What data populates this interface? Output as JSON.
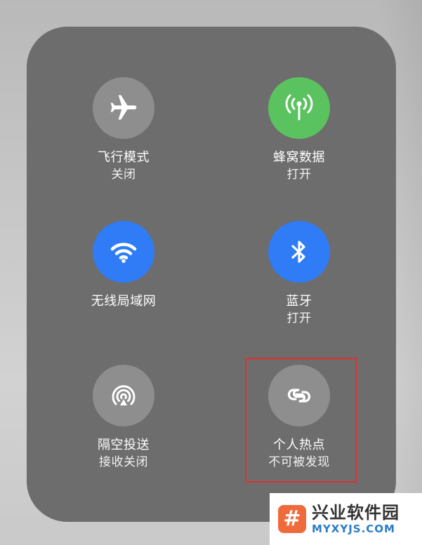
{
  "colors": {
    "panel": "#6d6d6d",
    "inactive": "#8e8e8e",
    "cellular": "#5ac25f",
    "wifi": "#2f7cf6",
    "bluetooth": "#2f7cf6",
    "highlight": "#e0302e"
  },
  "tiles": {
    "airplane": {
      "icon": "airplane-icon",
      "label": "飞行模式",
      "status": "关闭"
    },
    "cellular": {
      "icon": "cellular-antenna-icon",
      "label": "蜂窝数据",
      "status": "打开"
    },
    "wifi": {
      "icon": "wifi-icon",
      "label": "无线局域网"
    },
    "bluetooth": {
      "icon": "bluetooth-icon",
      "label": "蓝牙",
      "status": "打开"
    },
    "airdrop": {
      "icon": "airdrop-icon",
      "label": "隔空投送",
      "status": "接收关闭"
    },
    "hotspot": {
      "icon": "hotspot-icon",
      "label": "个人热点",
      "status": "不可被发现"
    }
  },
  "watermark": {
    "logo_glyph": "#",
    "title": "兴业软件园",
    "url": "MYXYJS.COM"
  }
}
